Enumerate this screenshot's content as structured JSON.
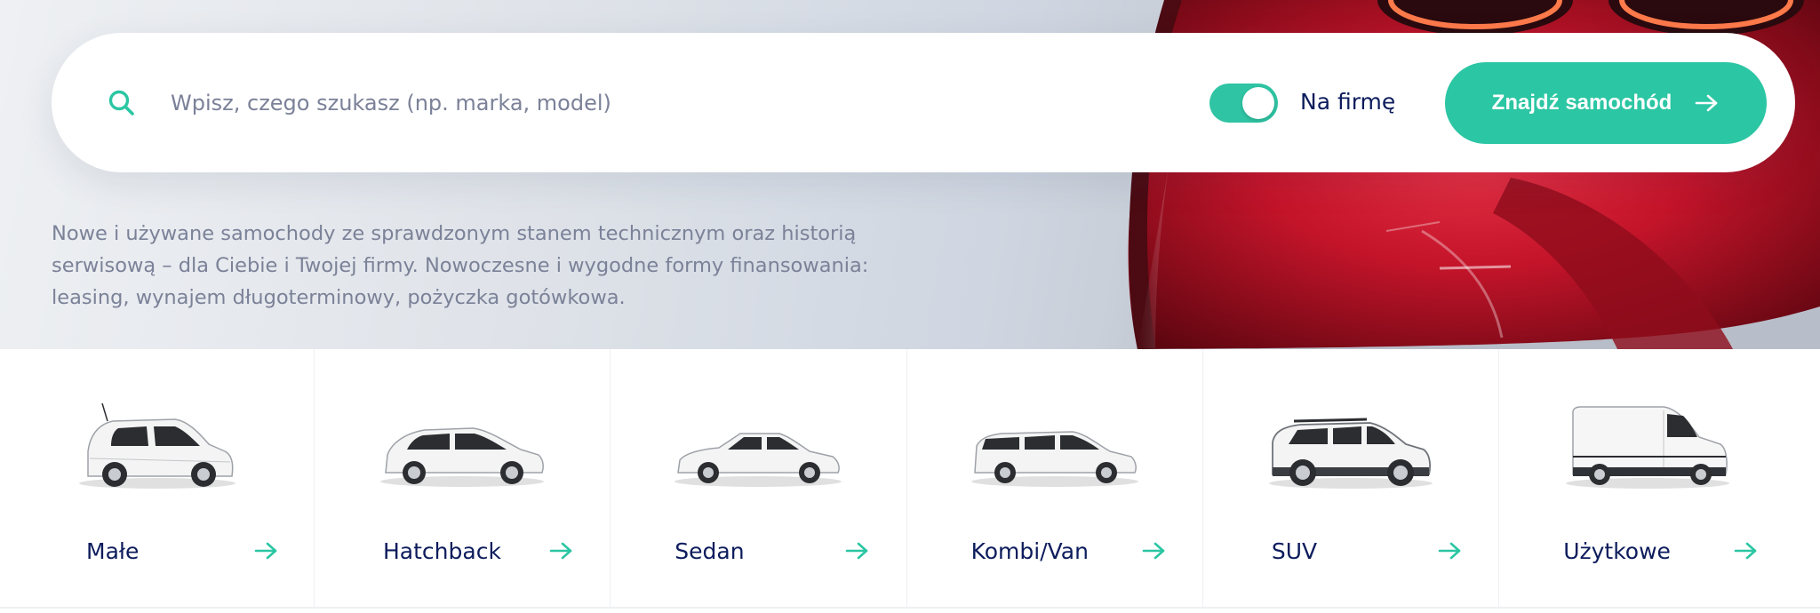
{
  "search": {
    "placeholder": "Wpisz, czego szukasz (np. marka, model)",
    "value": "",
    "company_toggle_label": "Na firmę",
    "company_toggle_on": true,
    "submit_label": "Znajdź samochód"
  },
  "hero": {
    "description": "Nowe i używane samochody ze sprawdzonym stanem technicznym oraz historią serwisową – dla Ciebie i Twojej firmy. Nowoczesne i wygodne formy finansowania: leasing, wynajem długoterminowy, pożyczka gotówkowa."
  },
  "categories": [
    {
      "label": "Małe",
      "icon": "small-car-icon"
    },
    {
      "label": "Hatchback",
      "icon": "hatchback-car-icon"
    },
    {
      "label": "Sedan",
      "icon": "sedan-car-icon"
    },
    {
      "label": "Kombi/Van",
      "icon": "estate-car-icon"
    },
    {
      "label": "SUV",
      "icon": "suv-car-icon"
    },
    {
      "label": "Użytkowe",
      "icon": "van-icon"
    }
  ],
  "colors": {
    "accent": "#2bc6a3",
    "text_dark": "#0d1c5c",
    "text_muted": "#7b8298",
    "hero_car": "#c4142a"
  }
}
